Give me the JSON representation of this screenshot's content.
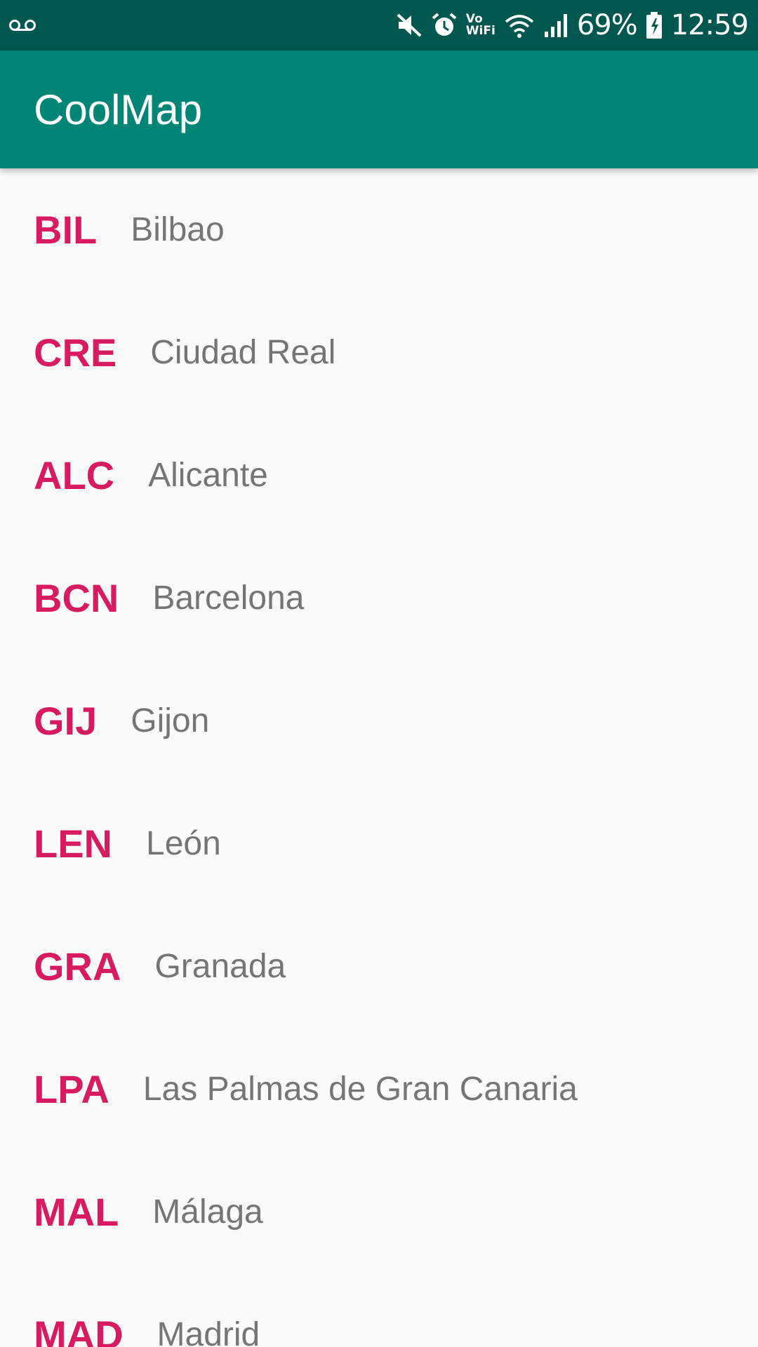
{
  "status_bar": {
    "left_icons": [
      "voicemail-icon"
    ],
    "right_icons": [
      "mute-icon",
      "alarm-icon",
      "vowifi-icon",
      "wifi-icon",
      "signal-icon"
    ],
    "vowifi_top": "Vo",
    "vowifi_bottom": "WiFi",
    "battery_percent": "69%",
    "time": "12:59",
    "background_color": "#00574f"
  },
  "app_bar": {
    "title": "CoolMap",
    "color": "#008577"
  },
  "colors": {
    "code": "#d81b60",
    "city": "#757575",
    "background": "#fafafa"
  },
  "airports": [
    {
      "code": "BIL",
      "city": "Bilbao"
    },
    {
      "code": "CRE",
      "city": "Ciudad Real"
    },
    {
      "code": "ALC",
      "city": "Alicante"
    },
    {
      "code": "BCN",
      "city": "Barcelona"
    },
    {
      "code": "GIJ",
      "city": "Gijon"
    },
    {
      "code": "LEN",
      "city": "León"
    },
    {
      "code": "GRA",
      "city": "Granada"
    },
    {
      "code": "LPA",
      "city": "Las Palmas de Gran Canaria"
    },
    {
      "code": "MAL",
      "city": "Málaga"
    },
    {
      "code": "MAD",
      "city": "Madrid"
    }
  ]
}
